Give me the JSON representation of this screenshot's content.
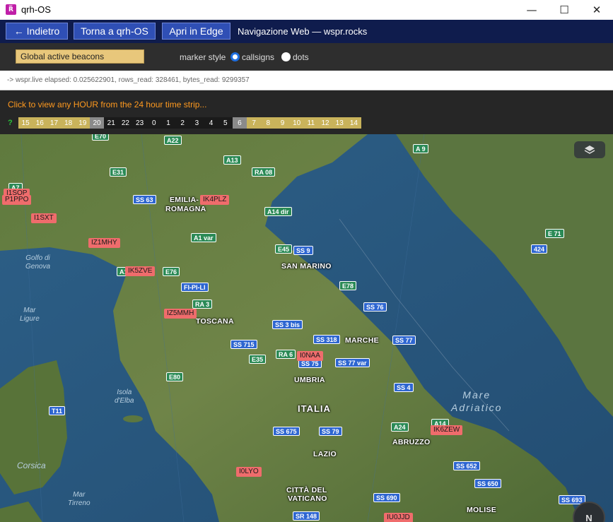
{
  "window": {
    "title": "qrh-OS",
    "app_icon": "qrh-app-icon",
    "icon_glyph": "R̅",
    "controls": {
      "minimize": "—",
      "maximize": "☐",
      "close": "✕"
    }
  },
  "toolbar": {
    "back_label": "← Indietro",
    "home_label": "Torna a qrh-OS",
    "edge_label": "Apri in Edge",
    "nav_label": "Navigazione Web — wspr.rocks"
  },
  "controls": {
    "beacons_label": "Global active beacons",
    "marker_style_label": "marker style",
    "option_callsigns": "callsigns",
    "option_dots": "dots",
    "selected": "callsigns"
  },
  "status": {
    "text": "-> wspr.live elapsed: 0.025622901, rows_read: 328461, bytes_read: 9299357"
  },
  "hours": {
    "prompt": "Click to view any HOUR from the 24 hour time strip...",
    "help": "?",
    "cells": [
      {
        "label": "15",
        "state": "y"
      },
      {
        "label": "16",
        "state": "y"
      },
      {
        "label": "17",
        "state": "y"
      },
      {
        "label": "18",
        "state": "y"
      },
      {
        "label": "19",
        "state": "y"
      },
      {
        "label": "20",
        "state": "sel"
      },
      {
        "label": "21",
        "state": "n"
      },
      {
        "label": "22",
        "state": "n"
      },
      {
        "label": "23",
        "state": "n"
      },
      {
        "label": "0",
        "state": "n"
      },
      {
        "label": "1",
        "state": "n"
      },
      {
        "label": "2",
        "state": "n"
      },
      {
        "label": "3",
        "state": "n"
      },
      {
        "label": "4",
        "state": "n"
      },
      {
        "label": "5",
        "state": "n"
      },
      {
        "label": "6",
        "state": "sel"
      },
      {
        "label": "7",
        "state": "y"
      },
      {
        "label": "8",
        "state": "y"
      },
      {
        "label": "9",
        "state": "y"
      },
      {
        "label": "10",
        "state": "y"
      },
      {
        "label": "11",
        "state": "y"
      },
      {
        "label": "12",
        "state": "y"
      },
      {
        "label": "13",
        "state": "y"
      },
      {
        "label": "14",
        "state": "y"
      }
    ]
  },
  "map": {
    "places": [
      "EMILIA-",
      "ROMAGNA",
      "SAN MARINO",
      "TOSCANA",
      "MARCHE",
      "UMBRIA",
      "ITALIA",
      "LAZIO",
      "ABRUZZO",
      "CITTÀ DEL",
      "VATICANO",
      "MOLISE"
    ],
    "seas": [
      "Golfo di\nGenova",
      "Mar\nLigure",
      "Isola\nd'Elba",
      "Corsica",
      "Mar\nTirreno",
      "Mare\nAdriatico"
    ],
    "roads": [
      "E70",
      "A22",
      "A13",
      "E31",
      "RA 08",
      "SS 63",
      "A7",
      "A14 dir",
      "A1 var",
      "E45",
      "SS 9",
      "A1",
      "E76",
      "FI-PI-LI",
      "RA 3",
      "E78",
      "SS 76",
      "SS 3 bis",
      "SS 318",
      "SS 715",
      "RA 6",
      "E35",
      "SS 75",
      "SS 77 var",
      "SS 77",
      "E80",
      "SS 4",
      "T11",
      "A24",
      "A14",
      "SS 675",
      "SS 79",
      "SS 652",
      "SS 650",
      "SS 690",
      "SR 148",
      "SS 693",
      "A 9",
      "E 71",
      "424"
    ],
    "callsigns": [
      "I1SOP",
      "P1PPO",
      "IK4PLZ",
      "I1SXT",
      "IZ1MHY",
      "IK5ZVE",
      "IZ5MMH",
      "I0NAA",
      "IK6ZEW",
      "I0LYO",
      "IU0JJD"
    ],
    "layers_icon": "layers-icon",
    "compass_label": "N"
  },
  "colors": {
    "toolbar_bg": "#0f1c4d",
    "button_bg": "#2f4fb5",
    "callsign_bg": "#ef6c6c",
    "prompt_text": "#ff9a1f",
    "hour_active": "#c9b35b"
  }
}
